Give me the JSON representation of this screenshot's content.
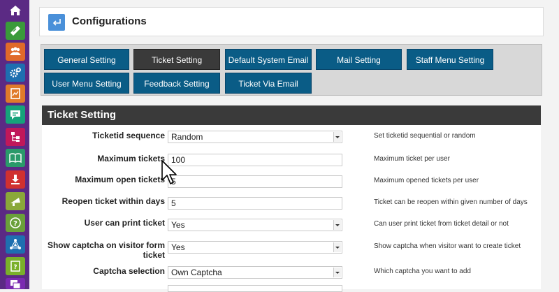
{
  "sidebar": {
    "items": [
      {
        "icon": "home-icon",
        "color": "#5b2a84"
      },
      {
        "icon": "ticket-icon",
        "color": "#3a9a3a"
      },
      {
        "icon": "users-icon",
        "color": "#e06a2a"
      },
      {
        "icon": "gear-icon",
        "color": "#1e6fb0"
      },
      {
        "icon": "report-icon",
        "color": "#e07a2a"
      },
      {
        "icon": "chat-icon",
        "color": "#16a37a"
      },
      {
        "icon": "hierarchy-icon",
        "color": "#c0185a"
      },
      {
        "icon": "book-icon",
        "color": "#2a9a6a"
      },
      {
        "icon": "download-icon",
        "color": "#d03030"
      },
      {
        "icon": "announcement-icon",
        "color": "#8aa83a"
      },
      {
        "icon": "help-icon",
        "color": "#6aa03a"
      },
      {
        "icon": "network-icon",
        "color": "#1e6fb0"
      },
      {
        "icon": "faq-icon",
        "color": "#7ab02a"
      },
      {
        "icon": "messages-icon",
        "color": "#7a2ab0"
      }
    ]
  },
  "header": {
    "title": "Configurations"
  },
  "tabs": [
    {
      "label": "General Setting"
    },
    {
      "label": "Ticket Setting"
    },
    {
      "label": "Default System Email"
    },
    {
      "label": "Mail Setting"
    },
    {
      "label": "Staff Menu Setting"
    },
    {
      "label": "User Menu Setting"
    },
    {
      "label": "Feedback Setting"
    },
    {
      "label": "Ticket Via Email"
    }
  ],
  "section": {
    "title": "Ticket Setting"
  },
  "settings": [
    {
      "label": "Ticketid sequence",
      "value": "Random",
      "help": "Set ticketid sequential or random"
    },
    {
      "label": "Maximum tickets",
      "value": "100",
      "help": "Maximum ticket per user"
    },
    {
      "label": "Maximum open tickets",
      "value": "5",
      "help": "Maximum opened tickets per user"
    },
    {
      "label": "Reopen ticket within days",
      "value": "5",
      "help": "Ticket can be reopen within given number of days"
    },
    {
      "label": "User can print ticket",
      "value": "Yes",
      "help": "Can user print ticket from ticket detail or not"
    },
    {
      "label": "Show captcha on visitor form ticket",
      "value": "Yes",
      "help": "Show captcha when visitor want to create ticket"
    },
    {
      "label": "Captcha selection",
      "value": "Own Captcha",
      "help": "Which captcha you want to add"
    }
  ]
}
